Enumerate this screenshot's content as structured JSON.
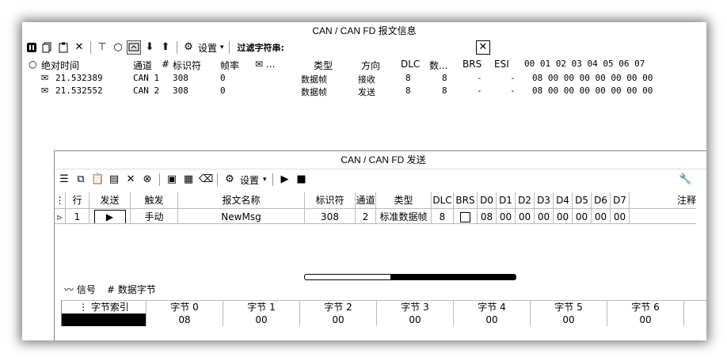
{
  "window1": {
    "title": "CAN / CAN FD 报文信息",
    "filter_label": "过滤字符串:",
    "filter_value": "",
    "toolbar_settings": "设置",
    "columns": [
      "绝对时间",
      "通道",
      "标识符",
      "帧率",
      "...",
      "类型",
      "方向",
      "DLC",
      "数...",
      "BRS",
      "ESI",
      "00 01 02 03 04 05 06 07"
    ],
    "rows": [
      {
        "time": "21.532389",
        "channel": "CAN 1",
        "id": "308",
        "rate": "0",
        "type": "数据帧",
        "direction": "接收",
        "dlc": "8",
        "len": "8",
        "brs": "-",
        "esi": "-",
        "data": "08 00 00 00 00 00 00 00"
      },
      {
        "time": "21.532552",
        "channel": "CAN 2",
        "id": "308",
        "rate": "0",
        "type": "数据帧",
        "direction": "发送",
        "dlc": "8",
        "len": "8",
        "brs": "-",
        "esi": "-",
        "data": "08 00 00 00 00 00 00 00"
      }
    ]
  },
  "window2": {
    "title": "CAN / CAN FD 发送",
    "toolbar_settings": "设置",
    "columns": [
      "行",
      "发送",
      "触发",
      "报文名称",
      "标识符",
      "通道",
      "类型",
      "DLC",
      "BRS",
      "D0",
      "D1",
      "D2",
      "D3",
      "D4",
      "D5",
      "D6",
      "D7",
      "注释"
    ],
    "row": {
      "line": "1",
      "trigger": "手动",
      "name": "NewMsg",
      "id": "308",
      "channel": "2",
      "type": "标准数据帧",
      "dlc": "8",
      "d": [
        "08",
        "00",
        "00",
        "00",
        "00",
        "00",
        "00",
        "00"
      ]
    },
    "tab_signal": "信号",
    "tab_bytes": "数据字节",
    "byte_headers": [
      "字节索引",
      "字节 0",
      "字节 1",
      "字节 2",
      "字节 3",
      "字节 4",
      "字节 5",
      "字节 6"
    ],
    "byte_values": [
      "",
      "08",
      "00",
      "00",
      "00",
      "00",
      "00",
      "00"
    ]
  }
}
